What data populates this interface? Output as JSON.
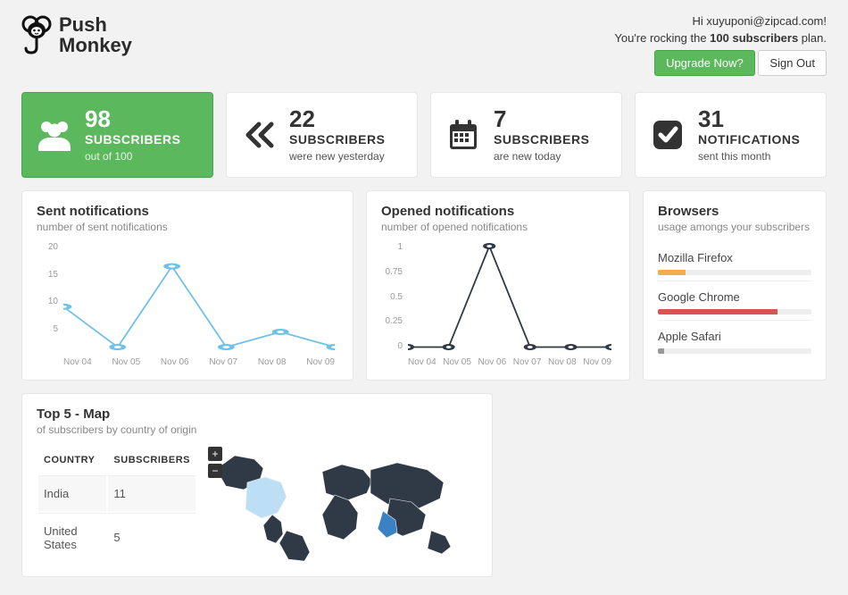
{
  "brand": {
    "name_line1": "Push",
    "name_line2": "Monkey"
  },
  "header": {
    "greeting": "Hi xuyuponi@zipcad.com!",
    "plan_prefix": "You're rocking the ",
    "plan_bold": "100 subscribers",
    "plan_suffix": " plan.",
    "upgrade": "Upgrade Now?",
    "signout": "Sign Out"
  },
  "cards": [
    {
      "value": "98",
      "label": "SUBSCRIBERS",
      "sub": "out of 100",
      "icon": "users-icon"
    },
    {
      "value": "22",
      "label": "SUBSCRIBERS",
      "sub": "were new yesterday",
      "icon": "chevrons-left-icon"
    },
    {
      "value": "7",
      "label": "SUBSCRIBERS",
      "sub": "are new today",
      "icon": "calendar-icon"
    },
    {
      "value": "31",
      "label": "NOTIFICATIONS",
      "sub": "sent this month",
      "icon": "check-square-icon"
    }
  ],
  "panels": {
    "sent": {
      "title": "Sent notifications",
      "sub": "number of sent notifications"
    },
    "opened": {
      "title": "Opened notifications",
      "sub": "number of opened notifications"
    },
    "browsers": {
      "title": "Browsers",
      "sub": "usage amongs your subscribers"
    },
    "map": {
      "title": "Top 5 - Map",
      "sub": "of subscribers by country of origin",
      "th_country": "COUNTRY",
      "th_subs": "SUBSCRIBERS"
    }
  },
  "browsers": [
    {
      "name": "Mozilla Firefox",
      "pct": 18,
      "color": "#f0ad4e"
    },
    {
      "name": "Google Chrome",
      "pct": 78,
      "color": "#d9534f"
    },
    {
      "name": "Apple Safari",
      "pct": 4,
      "color": "#999"
    }
  ],
  "map_table": [
    {
      "country": "India",
      "subs": "11"
    },
    {
      "country": "United States",
      "subs": "5"
    }
  ],
  "chart_data": [
    {
      "id": "sent",
      "type": "line",
      "categories": [
        "Nov 04",
        "Nov 05",
        "Nov 06",
        "Nov 07",
        "Nov 08",
        "Nov 09"
      ],
      "values": [
        8,
        0,
        16,
        0,
        3,
        0
      ],
      "yticks": [
        20,
        15,
        10,
        5,
        ""
      ],
      "ylim": [
        0,
        20
      ],
      "color": "#6fc1e8"
    },
    {
      "id": "opened",
      "type": "line",
      "categories": [
        "Nov 04",
        "Nov 05",
        "Nov 06",
        "Nov 07",
        "Nov 08",
        "Nov 09"
      ],
      "values": [
        0,
        0,
        1,
        0,
        0,
        0
      ],
      "yticks": [
        1,
        0.75,
        0.5,
        0.25,
        0
      ],
      "ylim": [
        0,
        1
      ],
      "color": "#2f3a46"
    }
  ]
}
